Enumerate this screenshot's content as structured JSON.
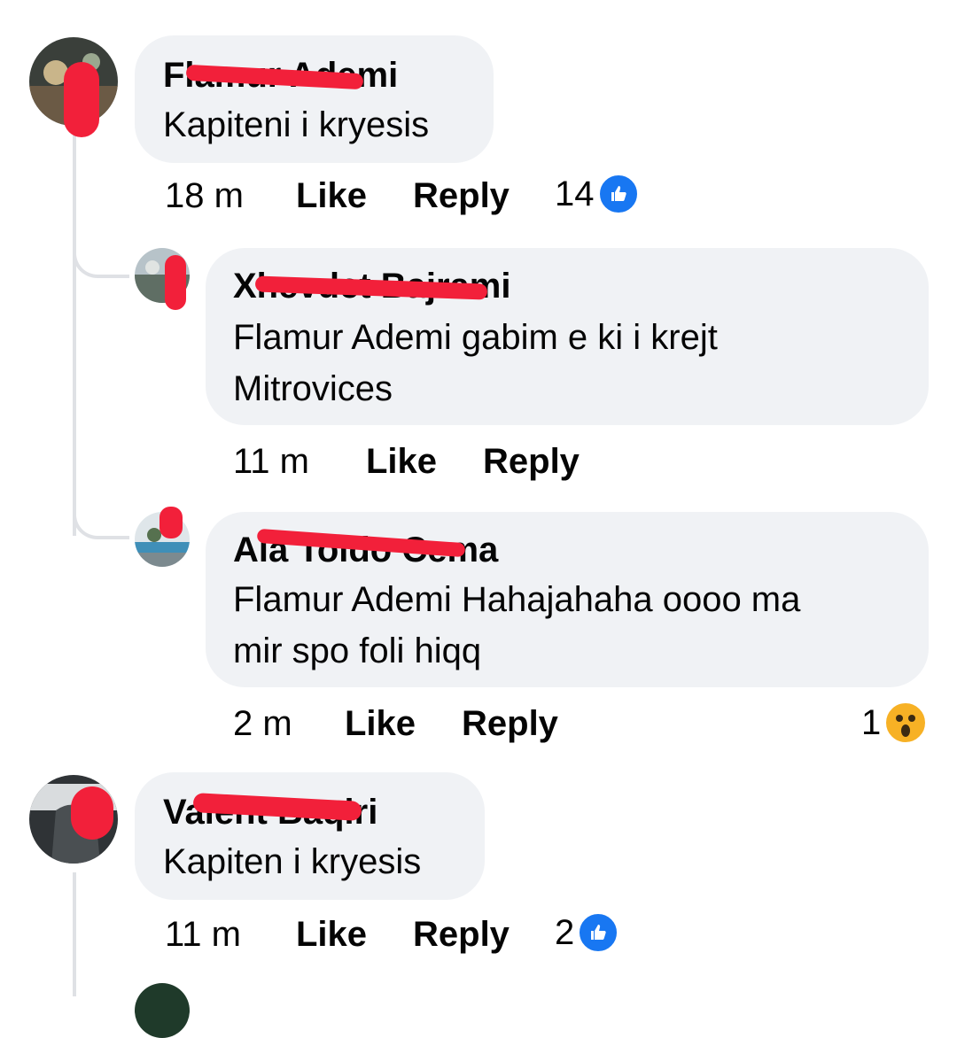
{
  "comments": [
    {
      "author": "Flamur Ademi",
      "text": "Kapiteni i kryesis",
      "time": "18 m",
      "like_label": "Like",
      "reply_label": "Reply",
      "reaction_count": "14",
      "reaction_icon": "like-icon"
    },
    {
      "author": "Xhevdet Bajrami",
      "text": "Flamur Ademi gabim e ki i krejt\nMitrovices",
      "time": "11 m",
      "like_label": "Like",
      "reply_label": "Reply"
    },
    {
      "author": "Ala Toldo Cema",
      "text": "Flamur Ademi Hahajahaha oooo ma\nmir spo foli hiqq",
      "time": "2 m",
      "like_label": "Like",
      "reply_label": "Reply",
      "reaction_count": "1",
      "reaction_icon": "wow-icon"
    },
    {
      "author": "Valent Baqiri",
      "text": "Kapiten i kryesis",
      "time": "11 m",
      "like_label": "Like",
      "reply_label": "Reply",
      "reaction_count": "2",
      "reaction_icon": "like-icon"
    }
  ],
  "colors": {
    "bubble": "#f0f2f5",
    "like_blue": "#1877f2",
    "redaction": "#f2203a",
    "thread_line": "#dfe1e5"
  }
}
